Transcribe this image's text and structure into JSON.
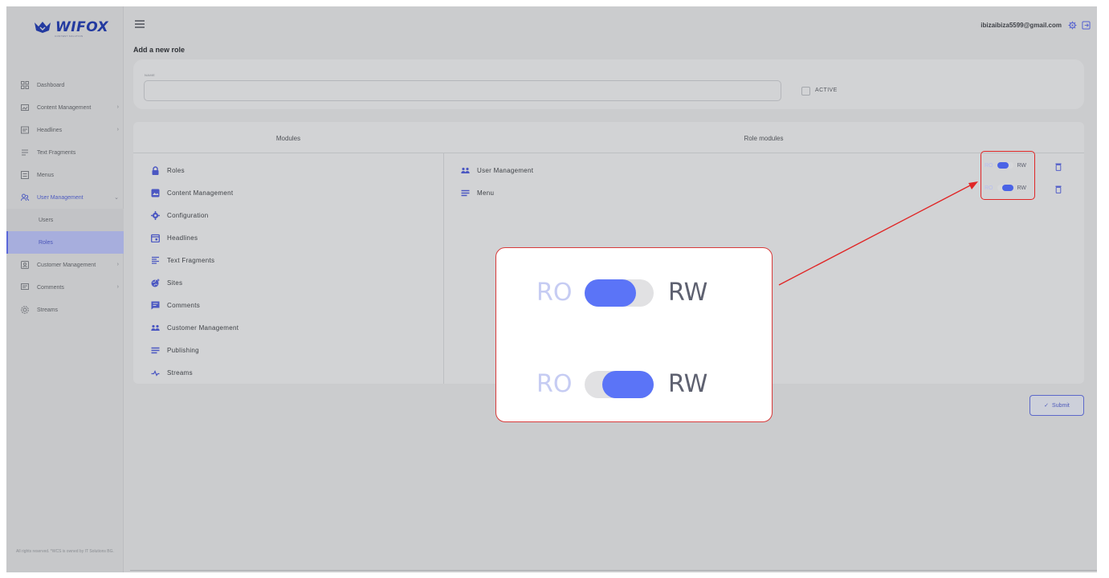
{
  "brand": {
    "name": "WIFOX",
    "tagline": "CONTENT SOLUTION"
  },
  "sidebar": {
    "items": [
      {
        "label": "Dashboard",
        "icon": "dashboard-icon",
        "chevron": false
      },
      {
        "label": "Content Management",
        "icon": "content-icon",
        "chevron": true
      },
      {
        "label": "Headlines",
        "icon": "headlines-icon",
        "chevron": true
      },
      {
        "label": "Text Fragments",
        "icon": "text-icon",
        "chevron": false
      },
      {
        "label": "Menus",
        "icon": "menu-icon",
        "chevron": false
      },
      {
        "label": "User Management",
        "icon": "users-icon",
        "chevron": true,
        "expanded": true
      }
    ],
    "subitems": [
      {
        "label": "Users",
        "selected": false
      },
      {
        "label": "Roles",
        "selected": true
      }
    ],
    "items_after": [
      {
        "label": "Customer Management",
        "icon": "customer-icon",
        "chevron": true
      },
      {
        "label": "Comments",
        "icon": "comments-icon",
        "chevron": true
      },
      {
        "label": "Streams",
        "icon": "streams-icon",
        "chevron": false
      }
    ],
    "footer": "All rights reserved. *WCS is owned by IT Solutions BG."
  },
  "topbar": {
    "email": "ibizaibiza5599@gmail.com"
  },
  "page": {
    "title": "Add a new role"
  },
  "form": {
    "name_label": "NAME",
    "name_value": "",
    "active_label": "ACTIVE",
    "active_checked": false
  },
  "modules": {
    "left_header": "Modules",
    "right_header": "Role modules",
    "available": [
      {
        "label": "Roles",
        "icon": "lock-icon"
      },
      {
        "label": "Content Management",
        "icon": "image-icon"
      },
      {
        "label": "Configuration",
        "icon": "gear-icon"
      },
      {
        "label": "Headlines",
        "icon": "calendar-icon"
      },
      {
        "label": "Text Fragments",
        "icon": "text-align-icon"
      },
      {
        "label": "Sites",
        "icon": "globe-icon"
      },
      {
        "label": "Comments",
        "icon": "comment-icon"
      },
      {
        "label": "Customer Management",
        "icon": "group-icon"
      },
      {
        "label": "Publishing",
        "icon": "list-icon"
      },
      {
        "label": "Streams",
        "icon": "stream-icon"
      }
    ],
    "assigned": [
      {
        "label": "User Management",
        "icon": "group-icon",
        "mode": "RO"
      },
      {
        "label": "Menu",
        "icon": "list-icon",
        "mode": "RW"
      }
    ],
    "toggle_ro": "RO",
    "toggle_rw": "RW"
  },
  "submit_label": "Submit",
  "callout": {
    "toggles": [
      {
        "ro": "RO",
        "rw": "RW",
        "mode": "RO"
      },
      {
        "ro": "RO",
        "rw": "RW",
        "mode": "RW"
      }
    ]
  },
  "colors": {
    "accent": "#5b74f7",
    "highlight": "#e02626"
  }
}
